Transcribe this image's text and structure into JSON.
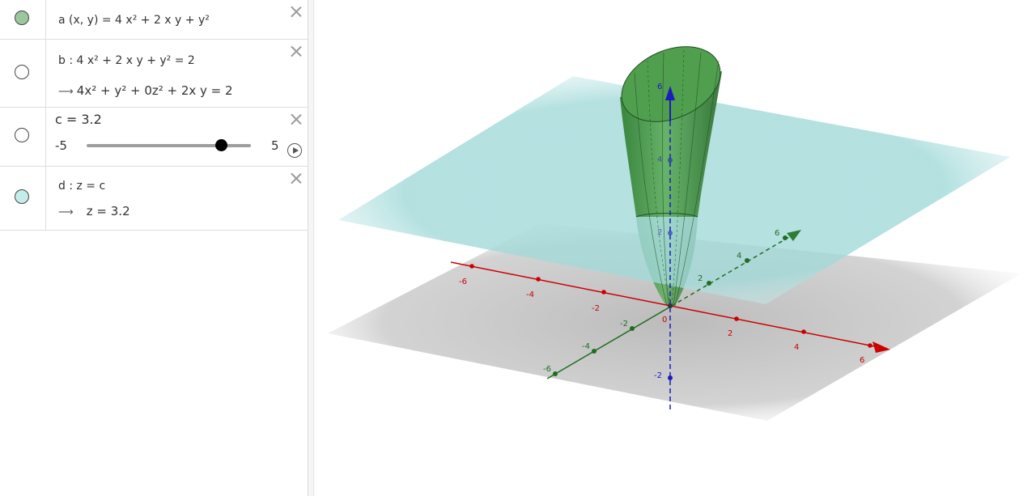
{
  "algebra": {
    "rows": [
      {
        "id": "a",
        "marble_color": "#9cc79e",
        "definition": "a (x, y)  =  4 x² + 2 x y + y²"
      },
      {
        "id": "b",
        "marble_color": "#ffffff",
        "definition": "b : 4 x² + 2 x y + y² = 2",
        "output": "4x² + y² + 0z² + 2x y = 2"
      },
      {
        "id": "c",
        "marble_color": "#ffffff",
        "definition": "c = 3.2",
        "slider": {
          "min": "-5",
          "max": "5",
          "value": 3.2,
          "min_value": -5,
          "max_value": 5
        }
      },
      {
        "id": "d",
        "marble_color": "#c4ecea",
        "definition": "d : z = c",
        "output": "z = 3.2"
      }
    ]
  },
  "view3d": {
    "colors": {
      "x_axis": "#cc0000",
      "y_axis": "#1e6e1e",
      "z_axis": "#1c1cba",
      "surface": "#3a8f3a",
      "plane": "#79d2d2"
    },
    "x_ticks": [
      "-6",
      "-4",
      "-2",
      "2",
      "4",
      "6"
    ],
    "y_ticks": [
      "-6",
      "-4",
      "-2",
      "2",
      "4",
      "6"
    ],
    "z_ticks": [
      "-2",
      "2",
      "4",
      "6"
    ],
    "origin_label": "0"
  },
  "icons": {
    "close": "close-icon",
    "play": "play-icon"
  }
}
